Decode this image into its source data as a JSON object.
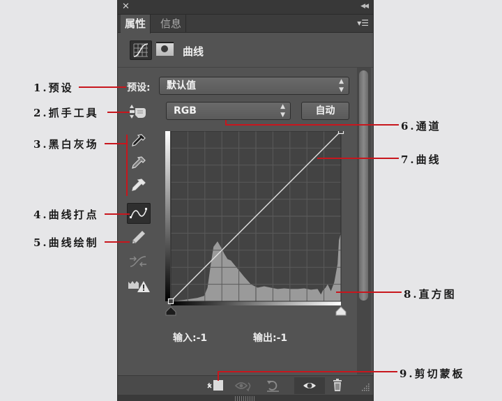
{
  "panel": {
    "close_icon": "close-icon",
    "collapse_icon": "double-chevron-left-icon",
    "tabs": [
      {
        "label": "属性",
        "active": true
      },
      {
        "label": "信息",
        "active": false
      }
    ],
    "menu_icon": "panel-menu-icon",
    "header": {
      "icon_adjustment": "curves-adjustment-icon",
      "icon_mask": "layer-mask-icon",
      "title": "曲线"
    },
    "preset": {
      "label": "预设:",
      "value": "默认值"
    },
    "channel": {
      "value": "RGB",
      "auto_label": "自动"
    },
    "tools": [
      {
        "name": "hand-adjust-tool",
        "icon": "hand-updown-icon"
      },
      {
        "name": "black-point-eyedropper",
        "icon": "eyedropper-black-icon"
      },
      {
        "name": "gray-point-eyedropper",
        "icon": "eyedropper-gray-icon"
      },
      {
        "name": "white-point-eyedropper",
        "icon": "eyedropper-white-icon"
      },
      {
        "name": "edit-points-tool",
        "icon": "curve-points-icon",
        "selected": true
      },
      {
        "name": "draw-curve-tool",
        "icon": "pencil-icon"
      },
      {
        "name": "smooth-curve-tool",
        "icon": "smooth-curve-icon"
      },
      {
        "name": "clipping-warning-tool",
        "icon": "histogram-warning-icon"
      }
    ],
    "readout": {
      "input_label": "输入:",
      "input_value": "-1",
      "output_label": "输出:",
      "output_value": "-1"
    },
    "bottom_toolbar": [
      {
        "name": "clip-to-layer-button",
        "icon": "clip-mask-icon"
      },
      {
        "name": "view-previous-state-button",
        "icon": "eye-toggle-icon"
      },
      {
        "name": "reset-button",
        "icon": "reset-icon"
      },
      {
        "name": "toggle-visibility-button",
        "icon": "eye-icon",
        "active": true
      },
      {
        "name": "delete-button",
        "icon": "trash-icon"
      }
    ]
  },
  "chart_data": {
    "type": "area",
    "title": "曲线",
    "xlabel": "输入",
    "ylabel": "输出",
    "xlim": [
      0,
      255
    ],
    "ylim": [
      0,
      255
    ],
    "grid": true,
    "grid_divisions": 10,
    "curve_points": [
      [
        0,
        0
      ],
      [
        255,
        255
      ]
    ],
    "histogram": {
      "x": [
        0,
        20,
        40,
        50,
        55,
        60,
        64,
        70,
        76,
        80,
        85,
        90,
        100,
        110,
        120,
        130,
        140,
        150,
        160,
        170,
        180,
        190,
        200,
        210,
        220,
        225,
        228,
        232,
        235,
        240,
        245,
        250,
        252,
        255
      ],
      "values": [
        0,
        2,
        5,
        8,
        20,
        55,
        80,
        88,
        78,
        70,
        62,
        60,
        48,
        36,
        25,
        20,
        22,
        20,
        18,
        19,
        18,
        18,
        19,
        17,
        18,
        10,
        16,
        20,
        25,
        15,
        28,
        55,
        90,
        100
      ]
    }
  },
  "annotations": [
    {
      "label": "1.预设"
    },
    {
      "label": "2.抓手工具"
    },
    {
      "label": "3.黑白灰场"
    },
    {
      "label": "4.曲线打点"
    },
    {
      "label": "5.曲线绘制"
    },
    {
      "label": "6.通道"
    },
    {
      "label": "7.曲线"
    },
    {
      "label": "8.直方图"
    },
    {
      "label": "9.剪切蒙板"
    }
  ],
  "colors": {
    "panel_bg": "#535353",
    "annotation_line": "#c8161d",
    "histogram_fill": "#9a9a9a",
    "graph_bg": "#434343"
  }
}
